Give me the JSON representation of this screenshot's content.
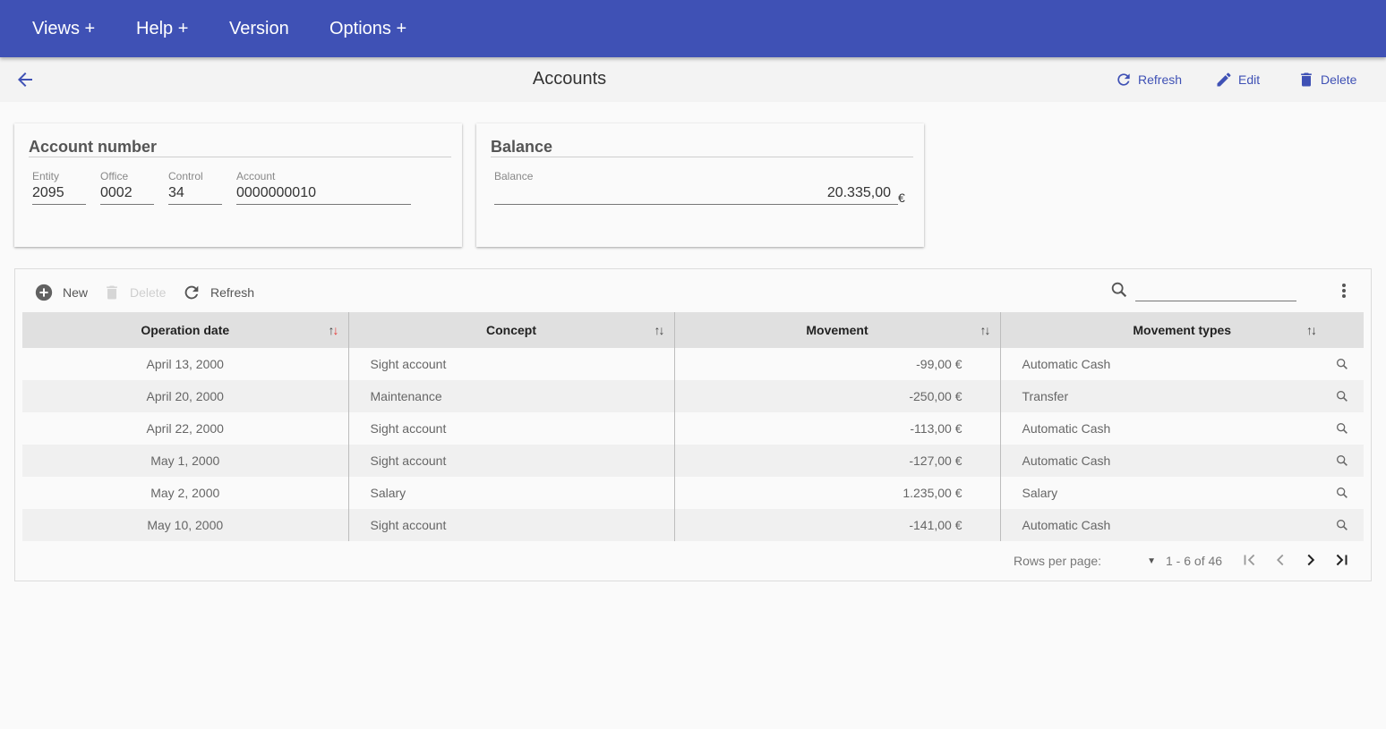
{
  "topbar": {
    "menu": [
      "Views +",
      "Help +",
      "Version",
      "Options +"
    ],
    "color": "#3f51b5"
  },
  "header": {
    "title": "Accounts",
    "actions": {
      "refresh": "Refresh",
      "edit": "Edit",
      "delete": "Delete"
    }
  },
  "account_card": {
    "title": "Account number",
    "fields": [
      {
        "label": "Entity",
        "value": "2095"
      },
      {
        "label": "Office",
        "value": "0002"
      },
      {
        "label": "Control",
        "value": "34"
      },
      {
        "label": "Account",
        "value": "0000000010"
      }
    ]
  },
  "balance_card": {
    "title": "Balance",
    "label": "Balance",
    "value": "20.335,00",
    "currency": "€"
  },
  "toolbar": {
    "new": "New",
    "delete": "Delete",
    "refresh": "Refresh",
    "search_value": ""
  },
  "table": {
    "columns": [
      "Operation date",
      "Concept",
      "Movement",
      "Movement types"
    ],
    "rows": [
      {
        "date": "April 13, 2000",
        "concept": "Sight account",
        "movement": "-99,00 €",
        "type": "Automatic Cash"
      },
      {
        "date": "April 20, 2000",
        "concept": "Maintenance",
        "movement": "-250,00 €",
        "type": "Transfer"
      },
      {
        "date": "April 22, 2000",
        "concept": "Sight account",
        "movement": "-113,00 €",
        "type": "Automatic Cash"
      },
      {
        "date": "May 1, 2000",
        "concept": "Sight account",
        "movement": "-127,00 €",
        "type": "Automatic Cash"
      },
      {
        "date": "May 2, 2000",
        "concept": "Salary",
        "movement": "1.235,00 €",
        "type": "Salary"
      },
      {
        "date": "May 10, 2000",
        "concept": "Sight account",
        "movement": "-141,00 €",
        "type": "Automatic Cash"
      }
    ]
  },
  "pagination": {
    "rows_per_page_label": "Rows per page:",
    "rows_per_page_value": "",
    "range": "1 - 6 of 46"
  }
}
